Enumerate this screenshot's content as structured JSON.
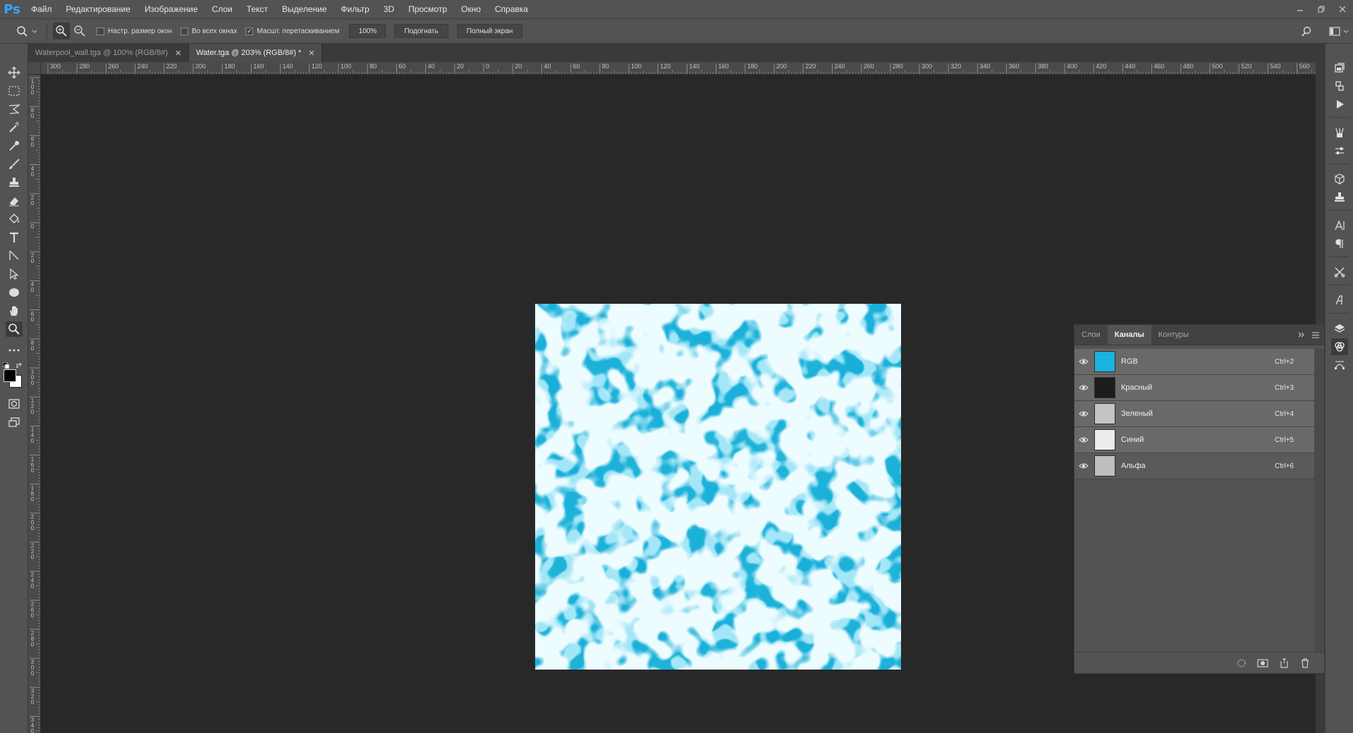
{
  "app": {
    "logo": "Ps"
  },
  "menu": [
    "Файл",
    "Редактирование",
    "Изображение",
    "Слои",
    "Текст",
    "Выделение",
    "Фильтр",
    "3D",
    "Просмотр",
    "Окно",
    "Справка"
  ],
  "options": {
    "resize_windows": {
      "label": "Настр. размер окон",
      "checked": false
    },
    "all_windows": {
      "label": "Во всех окнах",
      "checked": false
    },
    "scrubby_zoom": {
      "label": "Масшт. перетаскиванием",
      "checked": true
    },
    "zoom_value": "100%",
    "fit_label": "Подогнать",
    "fullscreen_label": "Полный экран"
  },
  "tabs": [
    {
      "title": "Waterpool_wall.tga @ 100% (RGB/8#)",
      "active": false
    },
    {
      "title": "Water.tga @ 203% (RGB/8#) *",
      "active": true
    }
  ],
  "ruler_h_labels": [
    "300",
    "280",
    "260",
    "240",
    "220",
    "200",
    "180",
    "160",
    "140",
    "120",
    "100",
    "80",
    "60",
    "40",
    "20",
    "0",
    "20",
    "40",
    "60",
    "80",
    "100",
    "120",
    "140",
    "160",
    "180",
    "200",
    "220",
    "240",
    "260",
    "280",
    "300",
    "320",
    "340",
    "360",
    "380",
    "400",
    "420",
    "440",
    "460",
    "480",
    "500",
    "520",
    "540",
    "560"
  ],
  "ruler_v_labels": [
    "100",
    "80",
    "60",
    "40",
    "20",
    "0",
    "20",
    "40",
    "60",
    "80",
    "100",
    "120",
    "140",
    "160",
    "180",
    "200",
    "220",
    "240",
    "260",
    "280",
    "300",
    "320",
    "340"
  ],
  "channels_panel": {
    "tabs": [
      {
        "label": "Слои",
        "active": false
      },
      {
        "label": "Каналы",
        "active": true
      },
      {
        "label": "Контуры",
        "active": false
      }
    ],
    "channels": [
      {
        "name": "RGB",
        "shortcut": "Ctrl+2",
        "thumb": "#1ab4dc"
      },
      {
        "name": "Красный",
        "shortcut": "Ctrl+3",
        "thumb": "#1c1c1c"
      },
      {
        "name": "Зеленый",
        "shortcut": "Ctrl+4",
        "thumb": "#c4c4c4"
      },
      {
        "name": "Синий",
        "shortcut": "Ctrl+5",
        "thumb": "#ececec"
      },
      {
        "name": "Альфа",
        "shortcut": "Ctrl+6",
        "thumb": "#bebebe"
      }
    ]
  },
  "colors": {
    "water": "#19b0da",
    "foreground": "#000000",
    "background": "#ffffff"
  }
}
